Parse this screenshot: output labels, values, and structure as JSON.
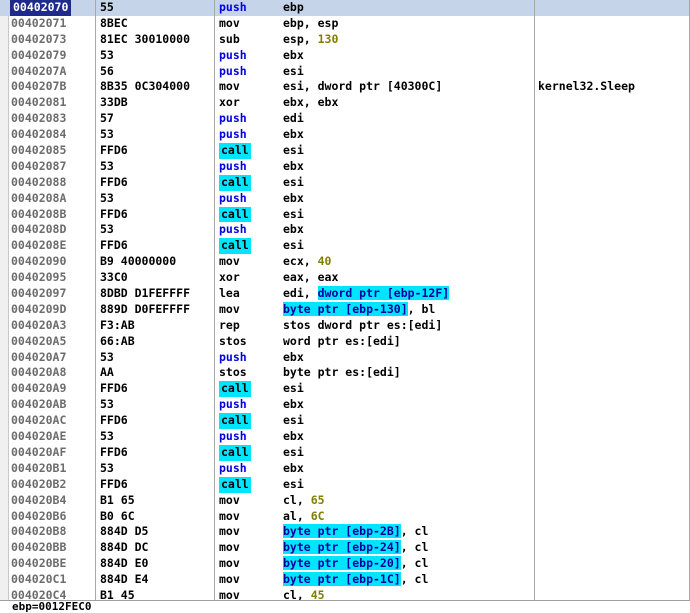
{
  "colors": {
    "address": "#6c6c6c",
    "push": "#0000e0",
    "call_highlight": "#00e5ff",
    "number": "#808000",
    "selection_row": "#c6d4ea",
    "selection_address": "#1f2b8c"
  },
  "selected_row": 0,
  "rows": [
    {
      "addr": "00402070",
      "hex": "55",
      "mn": "push",
      "ops": [
        {
          "t": "ebp"
        }
      ]
    },
    {
      "addr": "00402071",
      "hex": "8BEC",
      "mn": "mov",
      "ops": [
        {
          "t": "ebp, esp"
        }
      ]
    },
    {
      "addr": "00402073",
      "hex": "81EC 30010000",
      "mn": "sub",
      "ops": [
        {
          "t": "esp, "
        },
        {
          "t": "130",
          "c": "num"
        }
      ]
    },
    {
      "addr": "00402079",
      "hex": "53",
      "mn": "push",
      "ops": [
        {
          "t": "ebx"
        }
      ]
    },
    {
      "addr": "0040207A",
      "hex": "56",
      "mn": "push",
      "ops": [
        {
          "t": "esi"
        }
      ]
    },
    {
      "addr": "0040207B",
      "hex": "8B35 0C304000",
      "mn": "mov",
      "ops": [
        {
          "t": "esi, dword ptr [40300C]"
        }
      ],
      "comment": "kernel32.Sleep"
    },
    {
      "addr": "00402081",
      "hex": "33DB",
      "mn": "xor",
      "ops": [
        {
          "t": "ebx, ebx"
        }
      ]
    },
    {
      "addr": "00402083",
      "hex": "57",
      "mn": "push",
      "ops": [
        {
          "t": "edi"
        }
      ]
    },
    {
      "addr": "00402084",
      "hex": "53",
      "mn": "push",
      "ops": [
        {
          "t": "ebx"
        }
      ]
    },
    {
      "addr": "00402085",
      "hex": "FFD6",
      "mn": "call",
      "ops": [
        {
          "t": "esi"
        }
      ]
    },
    {
      "addr": "00402087",
      "hex": "53",
      "mn": "push",
      "ops": [
        {
          "t": "ebx"
        }
      ]
    },
    {
      "addr": "00402088",
      "hex": "FFD6",
      "mn": "call",
      "ops": [
        {
          "t": "esi"
        }
      ]
    },
    {
      "addr": "0040208A",
      "hex": "53",
      "mn": "push",
      "ops": [
        {
          "t": "ebx"
        }
      ]
    },
    {
      "addr": "0040208B",
      "hex": "FFD6",
      "mn": "call",
      "ops": [
        {
          "t": "esi"
        }
      ]
    },
    {
      "addr": "0040208D",
      "hex": "53",
      "mn": "push",
      "ops": [
        {
          "t": "ebx"
        }
      ]
    },
    {
      "addr": "0040208E",
      "hex": "FFD6",
      "mn": "call",
      "ops": [
        {
          "t": "esi"
        }
      ]
    },
    {
      "addr": "00402090",
      "hex": "B9 40000000",
      "mn": "mov",
      "ops": [
        {
          "t": "ecx, "
        },
        {
          "t": "40",
          "c": "num"
        }
      ]
    },
    {
      "addr": "00402095",
      "hex": "33C0",
      "mn": "xor",
      "ops": [
        {
          "t": "eax, eax"
        }
      ]
    },
    {
      "addr": "00402097",
      "hex": "8DBD D1FEFFFF",
      "mn": "lea",
      "ops": [
        {
          "t": "edi, "
        },
        {
          "t": "dword ptr [ebp-12F]",
          "c": "hl"
        }
      ]
    },
    {
      "addr": "0040209D",
      "hex": "889D D0FEFFFF",
      "mn": "mov",
      "ops": [
        {
          "t": "byte ptr [ebp-130]",
          "c": "hl"
        },
        {
          "t": ", bl"
        }
      ]
    },
    {
      "addr": "004020A3",
      "hex": "F3:AB",
      "mn": "rep",
      "ops": [
        {
          "t": "stos dword ptr es:[edi]"
        }
      ]
    },
    {
      "addr": "004020A5",
      "hex": "66:AB",
      "mn": "stos",
      "ops": [
        {
          "t": "word ptr es:[edi]"
        }
      ]
    },
    {
      "addr": "004020A7",
      "hex": "53",
      "mn": "push",
      "ops": [
        {
          "t": "ebx"
        }
      ]
    },
    {
      "addr": "004020A8",
      "hex": "AA",
      "mn": "stos",
      "ops": [
        {
          "t": "byte ptr es:[edi]"
        }
      ]
    },
    {
      "addr": "004020A9",
      "hex": "FFD6",
      "mn": "call",
      "ops": [
        {
          "t": "esi"
        }
      ]
    },
    {
      "addr": "004020AB",
      "hex": "53",
      "mn": "push",
      "ops": [
        {
          "t": "ebx"
        }
      ]
    },
    {
      "addr": "004020AC",
      "hex": "FFD6",
      "mn": "call",
      "ops": [
        {
          "t": "esi"
        }
      ]
    },
    {
      "addr": "004020AE",
      "hex": "53",
      "mn": "push",
      "ops": [
        {
          "t": "ebx"
        }
      ]
    },
    {
      "addr": "004020AF",
      "hex": "FFD6",
      "mn": "call",
      "ops": [
        {
          "t": "esi"
        }
      ]
    },
    {
      "addr": "004020B1",
      "hex": "53",
      "mn": "push",
      "ops": [
        {
          "t": "ebx"
        }
      ]
    },
    {
      "addr": "004020B2",
      "hex": "FFD6",
      "mn": "call",
      "ops": [
        {
          "t": "esi"
        }
      ]
    },
    {
      "addr": "004020B4",
      "hex": "B1 65",
      "mn": "mov",
      "ops": [
        {
          "t": "cl, "
        },
        {
          "t": "65",
          "c": "num"
        }
      ]
    },
    {
      "addr": "004020B6",
      "hex": "B0 6C",
      "mn": "mov",
      "ops": [
        {
          "t": "al, "
        },
        {
          "t": "6C",
          "c": "num"
        }
      ]
    },
    {
      "addr": "004020B8",
      "hex": "884D D5",
      "mn": "mov",
      "ops": [
        {
          "t": "byte ptr [ebp-2B]",
          "c": "hl"
        },
        {
          "t": ", cl"
        }
      ]
    },
    {
      "addr": "004020BB",
      "hex": "884D DC",
      "mn": "mov",
      "ops": [
        {
          "t": "byte ptr [ebp-24]",
          "c": "hl"
        },
        {
          "t": ", cl"
        }
      ]
    },
    {
      "addr": "004020BE",
      "hex": "884D E0",
      "mn": "mov",
      "ops": [
        {
          "t": "byte ptr [ebp-20]",
          "c": "hl"
        },
        {
          "t": ", cl"
        }
      ]
    },
    {
      "addr": "004020C1",
      "hex": "884D E4",
      "mn": "mov",
      "ops": [
        {
          "t": "byte ptr [ebp-1C]",
          "c": "hl"
        },
        {
          "t": ", cl"
        }
      ]
    },
    {
      "addr": "004020C4",
      "hex": "B1 45",
      "mn": "mov",
      "ops": [
        {
          "t": "cl, "
        },
        {
          "t": "45",
          "c": "num"
        }
      ]
    }
  ],
  "status": {
    "text": "ebp=0012FEC0"
  }
}
